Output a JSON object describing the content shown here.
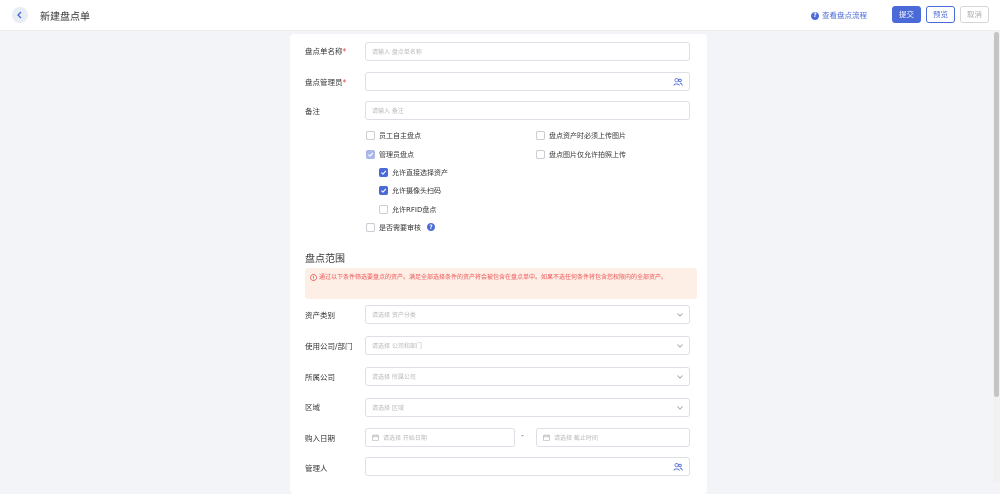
{
  "header": {
    "title": "新建盘点单",
    "flow_link": "查看盘点流程",
    "submit": "提交",
    "preview": "预览",
    "cancel": "取消"
  },
  "form": {
    "name": {
      "label": "盘点单名称",
      "required_mark": "*",
      "placeholder": "请输入 盘点单名称"
    },
    "manager": {
      "label": "盘点管理员",
      "required_mark": "*",
      "value": ""
    },
    "remark": {
      "label": "备注",
      "placeholder": "请输入 备注"
    },
    "options": {
      "employee_self": {
        "label": "员工自主盘点",
        "checked": false
      },
      "must_upload": {
        "label": "盘点资产时必须上传图片",
        "checked": false
      },
      "admin": {
        "label": "管理员盘点",
        "checked": true
      },
      "photo_only": {
        "label": "盘点图片仅允许拍照上传",
        "checked": false
      },
      "direct_select": {
        "label": "允许直接选择资产",
        "checked": true
      },
      "camera_scan": {
        "label": "允许摄像头扫码",
        "checked": true
      },
      "rfid": {
        "label": "允许RFID盘点",
        "checked": false
      },
      "need_review": {
        "label": "是否需要审核",
        "checked": false
      }
    }
  },
  "scope": {
    "title": "盘点范围",
    "notice": "通过以下条件筛选要盘点的资产。满足全部选择条件的资产将会被包含在盘点单中。如果不选任何条件将包含您权限内的全部资产。",
    "category": {
      "label": "资产类别",
      "placeholder": "请选择 资产分类"
    },
    "dept": {
      "label": "使用公司/部门",
      "placeholder": "请选择 公司和部门"
    },
    "company": {
      "label": "所属公司",
      "placeholder": "请选择 所属公司"
    },
    "area": {
      "label": "区域",
      "placeholder": "请选择 区域"
    },
    "purchase_date": {
      "label": "购入日期",
      "start_placeholder": "请选择 开始日期",
      "end_placeholder": "请选择 截止时间",
      "separator": "-"
    },
    "keeper": {
      "label": "管理人",
      "value": ""
    }
  },
  "colors": {
    "primary": "#4a6ad8",
    "warning_bg": "#fdeee6",
    "warning_text": "#e55555"
  }
}
